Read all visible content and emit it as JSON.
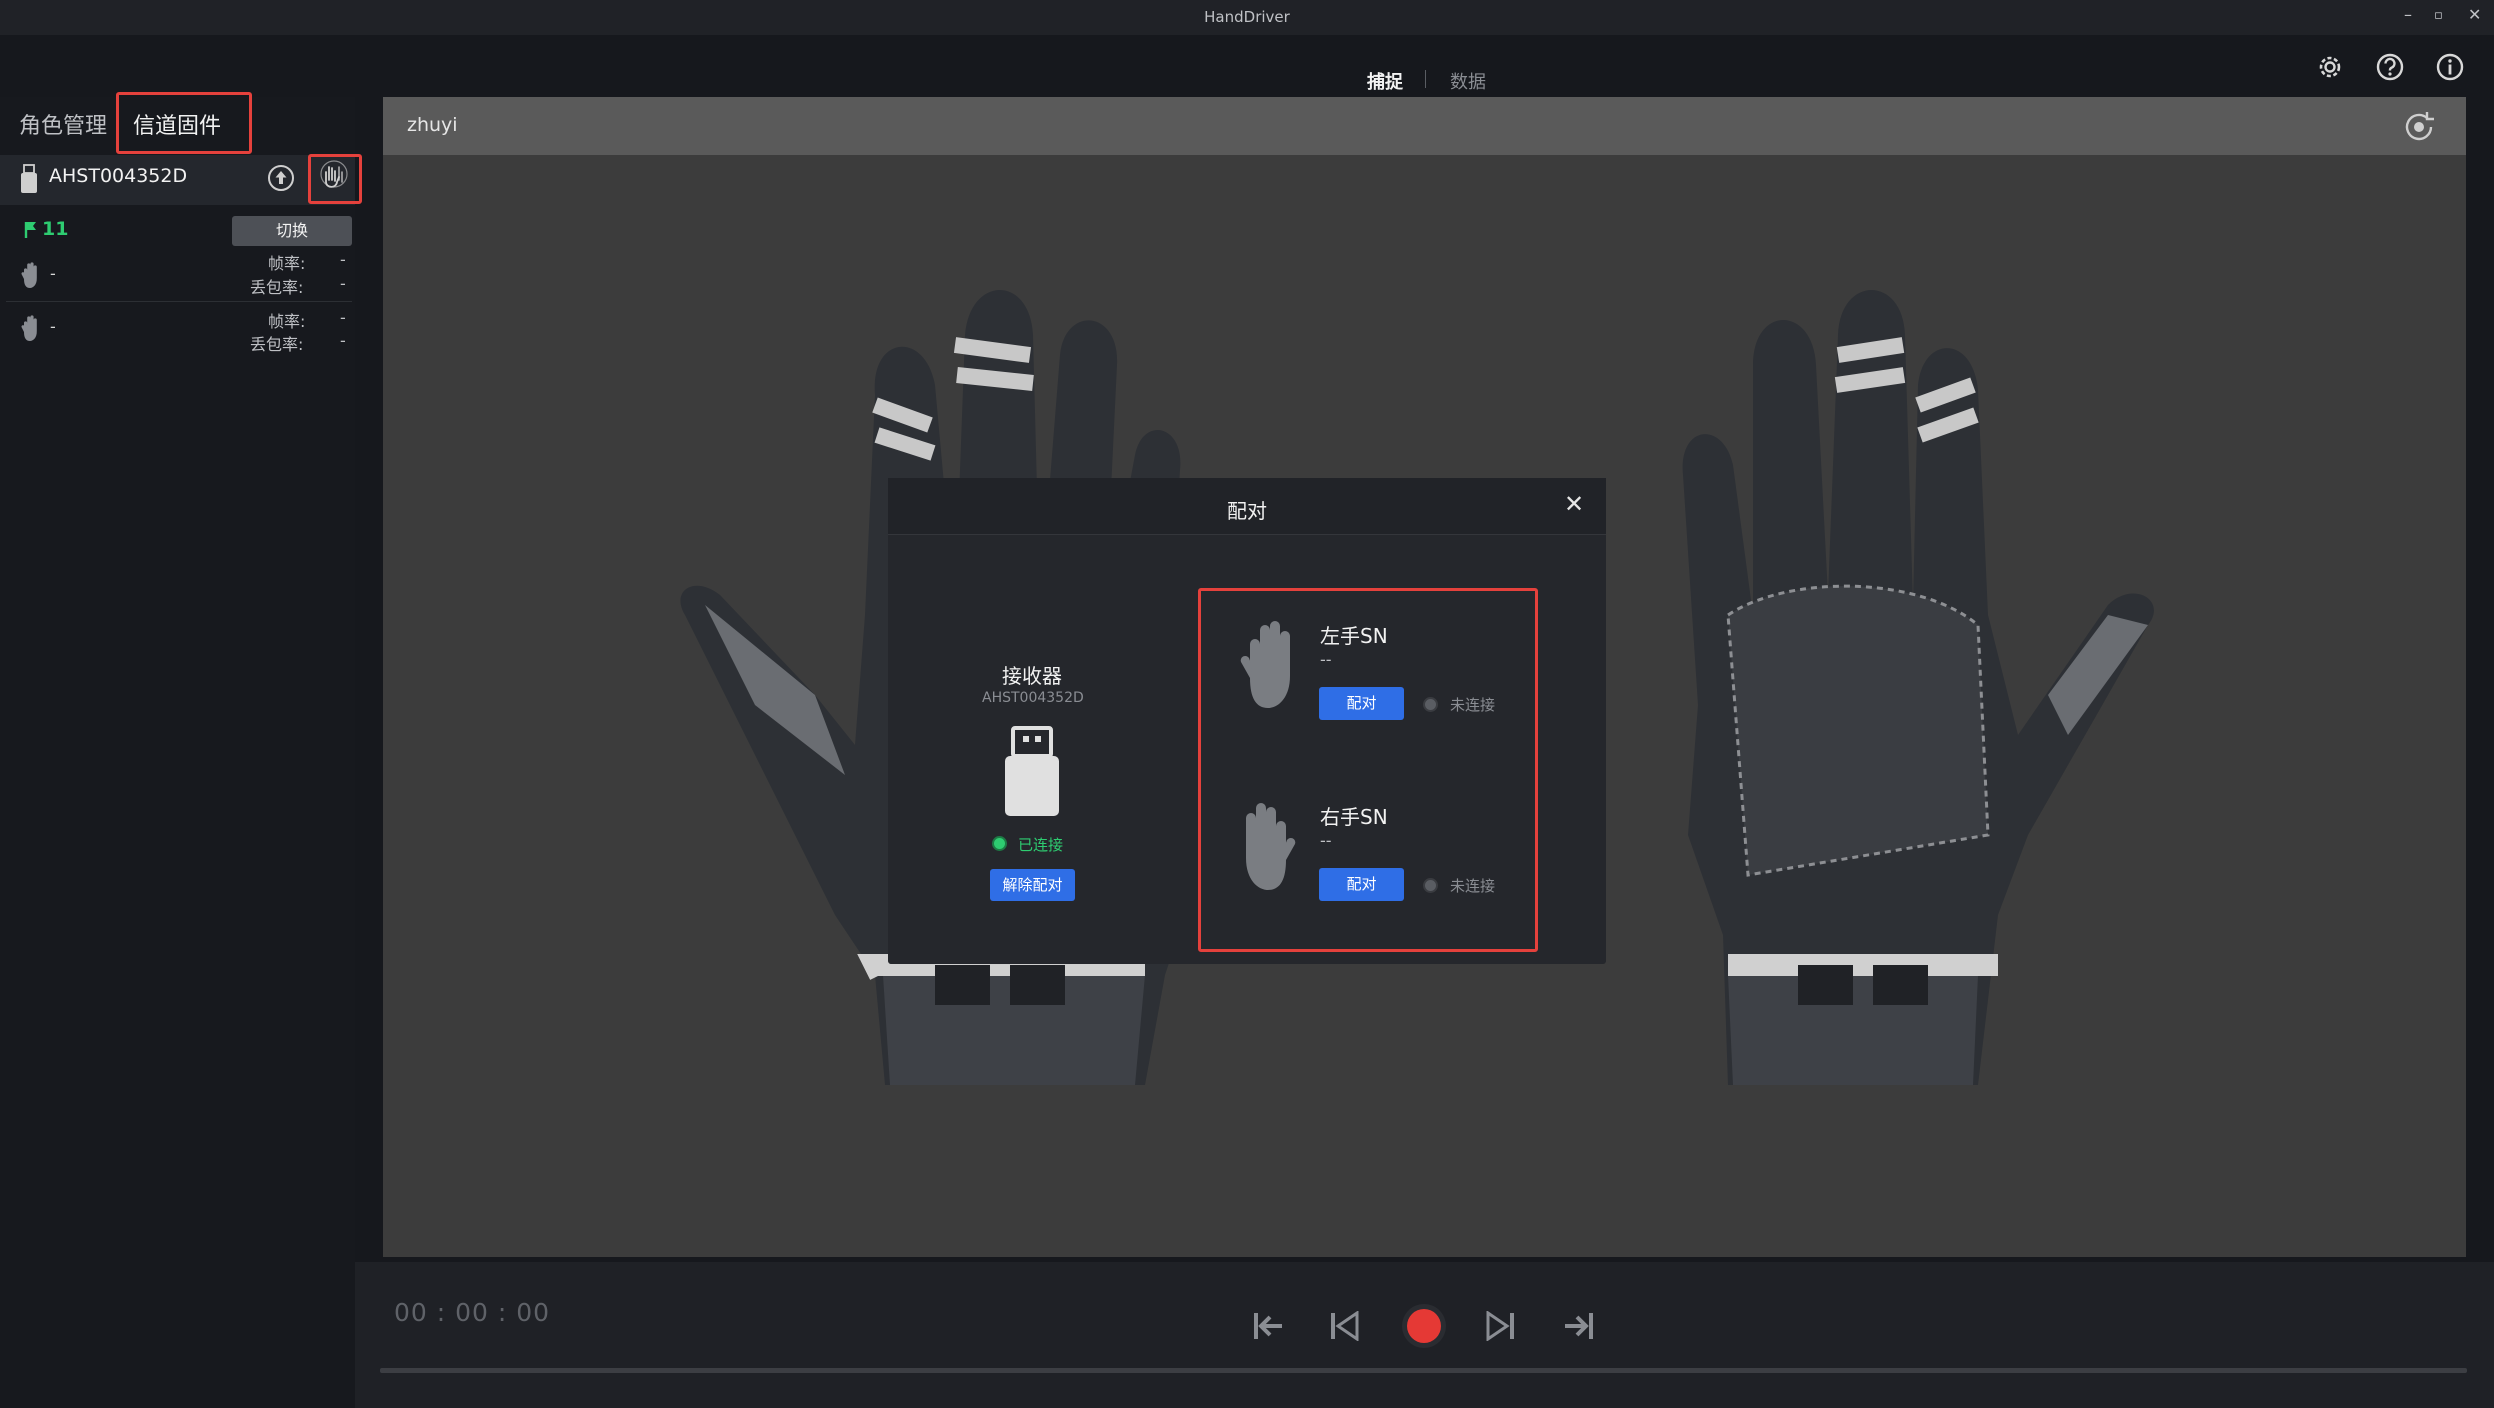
{
  "window": {
    "title": "HandDriver",
    "minimize": "–",
    "maximize": "▫",
    "close": "✕"
  },
  "top_tabs": {
    "capture": "捕捉",
    "data": "数据"
  },
  "top_icons": [
    "settings-icon",
    "help-icon",
    "info-icon"
  ],
  "sidebar": {
    "tabs": {
      "role": "角色管理",
      "channel": "信道固件"
    },
    "device": {
      "id": "AHST004352D"
    },
    "channel": {
      "label": "11",
      "switch": "切换"
    },
    "hands": [
      {
        "name": "-",
        "fps_label": "帧率:",
        "fps": "-",
        "loss_label": "丢包率:",
        "loss": "-"
      },
      {
        "name": "-",
        "fps_label": "帧率:",
        "fps": "-",
        "loss_label": "丢包率:",
        "loss": "-"
      }
    ]
  },
  "viewport": {
    "name": "zhuyi"
  },
  "playback": {
    "time": "00 : 00 : 00"
  },
  "modal": {
    "title": "配对",
    "close": "✕",
    "receiver": {
      "title": "接收器",
      "sn": "AHST004352D",
      "status": "已连接",
      "unpair": "解除配对"
    },
    "left": {
      "title": "左手SN",
      "sn": "--",
      "pair": "配对",
      "status": "未连接"
    },
    "right": {
      "title": "右手SN",
      "sn": "--",
      "pair": "配对",
      "status": "未连接"
    }
  },
  "colors": {
    "accent_blue": "#2f6ee6",
    "highlight_red": "#e5413c",
    "connected_green": "#2ecc71",
    "record_red": "#e53935"
  }
}
